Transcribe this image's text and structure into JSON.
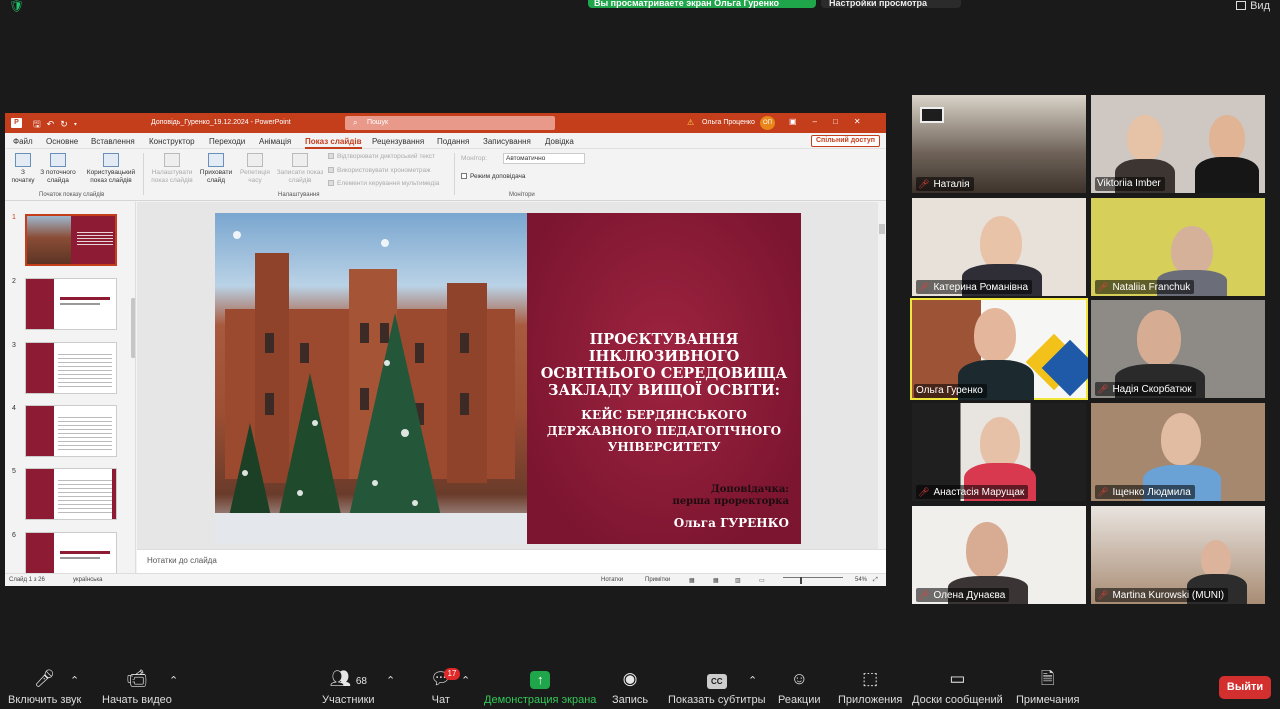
{
  "top": {
    "banner": "Вы просматриваете экран Ольга Гуренко",
    "view_settings": "Настройки просмотра",
    "view_label": "Вид"
  },
  "ppt": {
    "doc_title": "Доповідь_Гуренко_19.12.2024 - PowerPoint",
    "search_placeholder": "Пошук",
    "user_name": "Ольга Проценко",
    "user_initials": "ОП",
    "menu": [
      "Файл",
      "Основне",
      "Вставлення",
      "Конструктор",
      "Переходи",
      "Анімація",
      "Показ слайдів",
      "Рецензування",
      "Подання",
      "Записування",
      "Довідка"
    ],
    "share_button": "Спільний доступ",
    "ribbon": {
      "from_start": "З початку",
      "from_current": "З поточного слайда",
      "custom_show": "Користувацький показ слайдів",
      "group1": "Початок показу слайдів",
      "setup_show": "Налаштувати показ слайдів",
      "hide_slide": "Приховати слайд",
      "rehearse": "Репетиція часу",
      "record": "Записати показ слайдів",
      "play_narrations": "Відтворювати дикторський текст",
      "use_timings": "Використовувати хронометраж",
      "show_media": "Елементи керування мультимедіа",
      "group2": "Налаштування",
      "monitor_label": "Монітор:",
      "monitor_value": "Автоматично",
      "presenter_view": "Режим доповідача",
      "group3": "Монітори"
    },
    "slide_numbers": [
      "1",
      "2",
      "3",
      "4",
      "5",
      "6"
    ],
    "slide": {
      "title": "Проєктування інклюзивного освітнього середовища закладу вищої освіти:",
      "subtitle": "КЕЙС БЕРДЯНСЬКОГО ДЕРЖАВНОГО ПЕДАГОГІЧНОГО УНІВЕРСИТЕТУ",
      "speaker_label": "Доповідачка:",
      "speaker_role": "перша проректорка",
      "speaker_name": "Ольга ГУРЕНКО"
    },
    "notes_placeholder": "Нотатки до слайда",
    "status": {
      "slide_of": "Слайд 1 з 26",
      "language": "українська",
      "notes_btn": "Нотатки",
      "comments_btn": "Примітки",
      "zoom": "54%"
    }
  },
  "participants": [
    "Наталія",
    "Viktoriia Imber",
    "Катерина Романівна",
    "Nataliia Franchuk",
    "Ольга Гуренко",
    "Надія Скорбатюк",
    "Анастасія Марущак",
    "Іщенко Людмила",
    "Олена Дунаєва",
    "Martina Kurowski (MUNI)"
  ],
  "toolbar": {
    "unmute": "Включить звук",
    "video": "Начать видео",
    "participants": "Участники",
    "participants_count": "68",
    "chat": "Чат",
    "chat_badge": "17",
    "share": "Демонстрация экрана",
    "record": "Запись",
    "captions": "Показать субтитры",
    "captions_icon": "CC",
    "reactions": "Реакции",
    "apps": "Приложения",
    "whiteboards": "Доски сообщений",
    "notes": "Примечания",
    "leave": "Выйти"
  }
}
